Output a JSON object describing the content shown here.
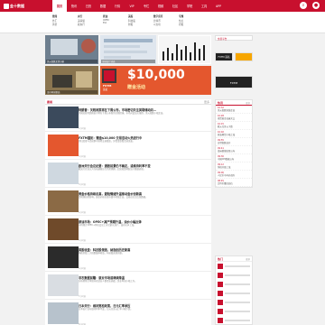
{
  "topbar": {
    "logo_text": "金十数据",
    "nav": [
      "首页",
      "快讯",
      "日历",
      "数据",
      "行情",
      "VIP",
      "专栏",
      "视频",
      "社区",
      "学院",
      "工具",
      "APP"
    ],
    "active_index": 0,
    "icons": [
      "search-icon",
      "user-icon"
    ]
  },
  "subnav": {
    "columns": [
      {
        "head": "要闻",
        "items": [
          "外汇",
          "黄金"
        ]
      },
      {
        "head": "央行",
        "items": [
          "美联储",
          "欧央行"
        ]
      },
      {
        "head": "原油",
        "items": [
          "OPEC",
          "EIA"
        ]
      },
      {
        "head": "美股",
        "items": [
          "科技股",
          "财报"
        ]
      },
      {
        "head": "数字货币",
        "items": [
          "比特币",
          "以太坊"
        ]
      },
      {
        "head": "专题",
        "items": [
          "热点",
          "研报"
        ]
      }
    ]
  },
  "banners": {
    "promo_amount": "$10,000",
    "promo_sub": "赠金活动",
    "promo_brand": "FXTM",
    "promo_brand_sub": "富拓",
    "captions": [
      "美元指数走势分析",
      "全球央行动态",
      "金价再创新高",
      "原油供需观察"
    ]
  },
  "right_ads": [
    "FXTM 富拓",
    "交易平台",
    "FXTM"
  ],
  "main": {
    "tab": "要闻",
    "more": "更多",
    "articles": [
      {
        "title": "特朗普：关税政策将在下周公布，市场密切关注美联储动向…",
        "summary": "美国总统特朗普表示将在下周公布新的关税措施，市场对此反应强烈，美元指数小幅走高。",
        "meta": "2小时前"
      },
      {
        "title": "FXTM富拓：赠金$10,000 交易活动火热进行中",
        "summary": "即日起参与活动即可获得交易赠金，详情请查看活动页面。",
        "meta": "3小时前"
      },
      {
        "title": "欧洲央行会议纪要：通胀前景仍不确定，或维持利率不变",
        "summary": "欧央行官员认为当前通胀压力仍需观察，后续政策将取决于数据表现。",
        "meta": "3小时前"
      },
      {
        "title": "黄金价格持续走高，避险情绪升温推动金价创新高",
        "summary": "受地缘局势影响，黄金价格在亚市盘中持续走高，交易员关注后续数据。",
        "meta": "4小时前"
      },
      {
        "title": "原油市场：OPEC+减产预期升温，油价小幅反弹",
        "summary": "市场预计OPEC+将在会议上讨论延长减产，油价应声上涨。",
        "meta": "5小时前"
      },
      {
        "title": "美股收盘：科技股领涨，纳指创历史新高",
        "summary": "隔夜美股三大指数集体收涨，科技股表现亮眼。",
        "meta": "6小时前"
      },
      {
        "title": "非农数据前瞻：就业市场或继续降温",
        "summary": "分析师预计本周非农就业人数增长放缓，失业率或小幅上升。",
        "meta": "7小时前"
      },
      {
        "title": "日本央行：维持宽松政策，日元汇率承压",
        "summary": "日本央行宣布维持利率不变，日元兑美元汇率小幅下跌。",
        "meta": "8小时前"
      }
    ]
  },
  "sidebar": {
    "head": "快讯",
    "more": "更多",
    "items": [
      {
        "time": "10:32",
        "text": "美元指数短线走高"
      },
      {
        "time": "10:28",
        "text": "现货黄金突破关口"
      },
      {
        "time": "10:15",
        "text": "欧元兑美元下跌"
      },
      {
        "time": "10:02",
        "text": "原油期货小幅上涨"
      },
      {
        "time": "09:55",
        "text": "日经指数高开"
      },
      {
        "time": "09:41",
        "text": "澳洲联储纪要公布"
      },
      {
        "time": "09:30",
        "text": "中国CPI数据公布"
      },
      {
        "time": "09:12",
        "text": "恒指开盘上涨"
      },
      {
        "time": "09:00",
        "text": "人民币中间价调升"
      },
      {
        "time": "08:45",
        "text": "比特币重回高位"
      }
    ]
  },
  "sidebar2": {
    "head": "热门",
    "more": "更多"
  },
  "colors": {
    "brand": "#c8102e",
    "promo_bg": "#e4572e"
  }
}
